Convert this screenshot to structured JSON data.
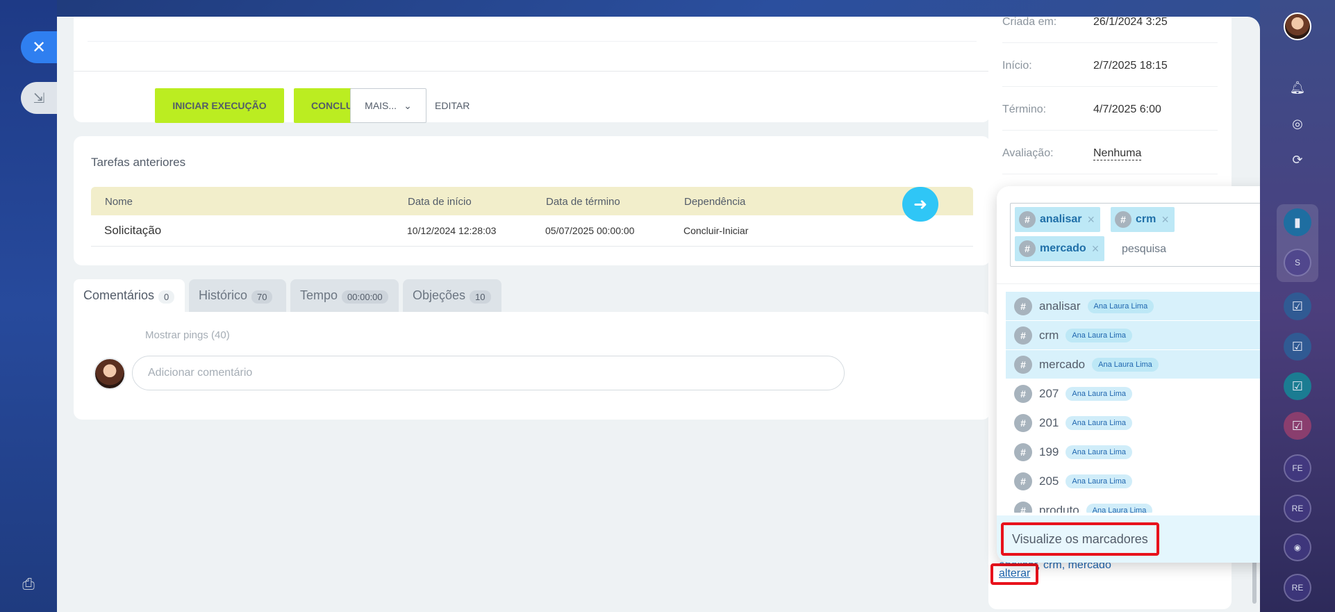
{
  "toolbar": {
    "start": "INICIAR EXECUÇÃO",
    "finish": "CONCLUIR",
    "more": "MAIS...",
    "edit": "EDITAR"
  },
  "previous": {
    "title": "Tarefas anteriores",
    "headers": [
      "Nome",
      "Data de início",
      "Data de término",
      "Dependência"
    ],
    "rows": [
      {
        "name": "Solicitação",
        "start": "10/12/2024 12:28:03",
        "end": "05/07/2025 00:00:00",
        "dep": "Concluir-Iniciar"
      }
    ]
  },
  "tabs": [
    {
      "label": "Comentários",
      "count": "0"
    },
    {
      "label": "Histórico",
      "count": "70"
    },
    {
      "label": "Tempo",
      "count": "00:00:00"
    },
    {
      "label": "Objeções",
      "count": "10"
    }
  ],
  "comments": {
    "pings": "Mostrar pings (40)",
    "placeholder": "Adicionar comentário"
  },
  "info": {
    "rows": [
      {
        "label": "Criada em:",
        "value": "26/1/2024 3:25"
      },
      {
        "label": "Início:",
        "value": "2/7/2025 18:15"
      },
      {
        "label": "Término:",
        "value": "4/7/2025 6:00"
      },
      {
        "label": "Avaliação:",
        "value": "Nenhuma"
      }
    ],
    "tags_summary": "analisar, crm, mercado",
    "change": "alterar"
  },
  "popup": {
    "chips": [
      "analisar",
      "crm",
      "mercado"
    ],
    "search_placeholder": "pesquisa",
    "items": [
      {
        "tag": "analisar",
        "user": "Ana Laura Lima",
        "selected": true
      },
      {
        "tag": "crm",
        "user": "Ana Laura Lima",
        "selected": true
      },
      {
        "tag": "mercado",
        "user": "Ana Laura Lima",
        "selected": true
      },
      {
        "tag": "207",
        "user": "Ana Laura Lima",
        "selected": false
      },
      {
        "tag": "201",
        "user": "Ana Laura Lima",
        "selected": false
      },
      {
        "tag": "199",
        "user": "Ana Laura Lima",
        "selected": false
      },
      {
        "tag": "205",
        "user": "Ana Laura Lima",
        "selected": false
      },
      {
        "tag": "produto",
        "user": "Ana Laura Lima",
        "selected": false
      }
    ],
    "view_tags": "Visualize os marcadores"
  },
  "rightbar": {
    "letters": [
      "S",
      "FE",
      "RE",
      "RE"
    ]
  }
}
